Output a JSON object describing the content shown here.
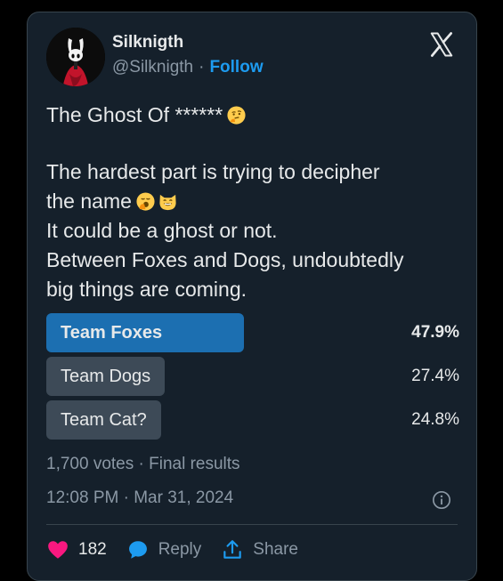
{
  "author": {
    "name": "Silknigth",
    "handle": "@Silknigth",
    "follow_label": "Follow",
    "separator": "·"
  },
  "tweet": {
    "line1": "The Ghost Of ******",
    "line2": "The hardest part is trying to decipher",
    "line3": "the name",
    "line4": "It could be a ghost or not.",
    "line5": "Between Foxes and Dogs, undoubtedly",
    "line6": "big things are coming."
  },
  "poll": {
    "options": [
      {
        "label": "Team Foxes",
        "percent": "47.9%",
        "fraction": 0.479
      },
      {
        "label": "Team Dogs",
        "percent": "27.4%",
        "fraction": 0.274
      },
      {
        "label": "Team Cat?",
        "percent": "24.8%",
        "fraction": 0.248
      }
    ],
    "meta": "1,700 votes · Final results"
  },
  "timestamp": "12:08 PM · Mar 31, 2024",
  "actions": {
    "likes": "182",
    "reply_label": "Reply",
    "share_label": "Share"
  },
  "colors": {
    "accent": "#1d9bf0",
    "winner_bar": "#1c6fb1",
    "bar": "#3d4a57",
    "like": "#f91880",
    "background": "#15202b"
  },
  "icons": [
    "x-logo-icon",
    "thinking-face-icon",
    "yawning-face-icon",
    "grinning-cat-icon",
    "info-icon",
    "heart-icon",
    "reply-bubble-icon",
    "share-icon"
  ]
}
